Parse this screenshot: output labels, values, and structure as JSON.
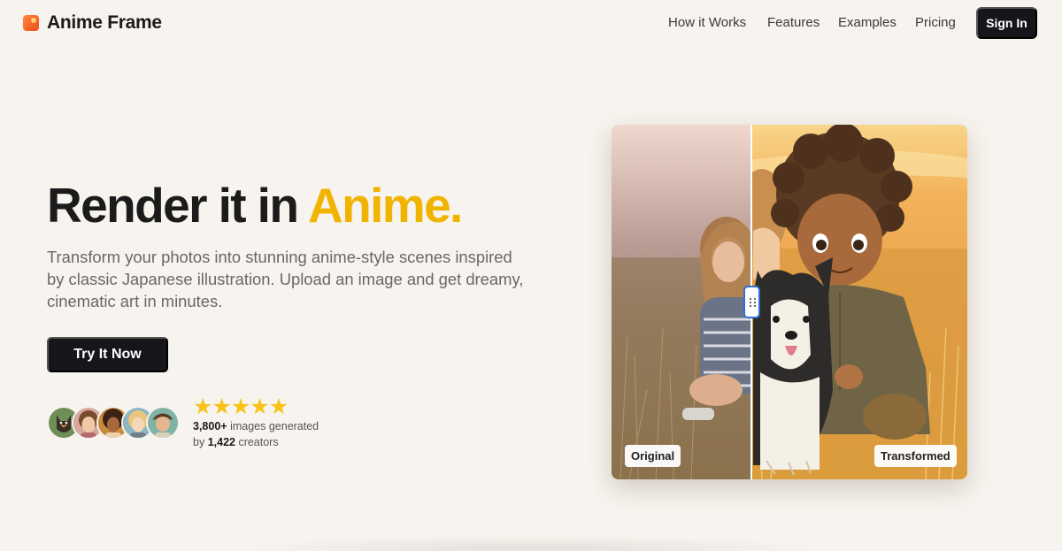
{
  "brand": {
    "name": "Anime Frame"
  },
  "nav": {
    "links": [
      "How it Works",
      "Features",
      "Examples",
      "Pricing"
    ],
    "signin_label": "Sign In"
  },
  "hero": {
    "headline_main": "Render it in ",
    "headline_accent": "Anime.",
    "subtitle": "Transform your photos into stunning anime-style scenes inspired by classic Japanese illustration. Upload an image and get dreamy, cinematic art in minutes.",
    "cta_label": "Try It Now",
    "rating_stars": 5,
    "images_count": "3,800+",
    "images_text": " images generated",
    "by_text": "by ",
    "creators_count": "1,422",
    "creators_text": " creators"
  },
  "compare": {
    "original_label": "Original",
    "transformed_label": "Transformed",
    "slider_position": 0.39
  },
  "colors": {
    "background": "#f7f3ee",
    "accent": "#f0b400",
    "button": "#16161a",
    "star": "#f7c318",
    "handle_border": "#2f6fd6"
  }
}
